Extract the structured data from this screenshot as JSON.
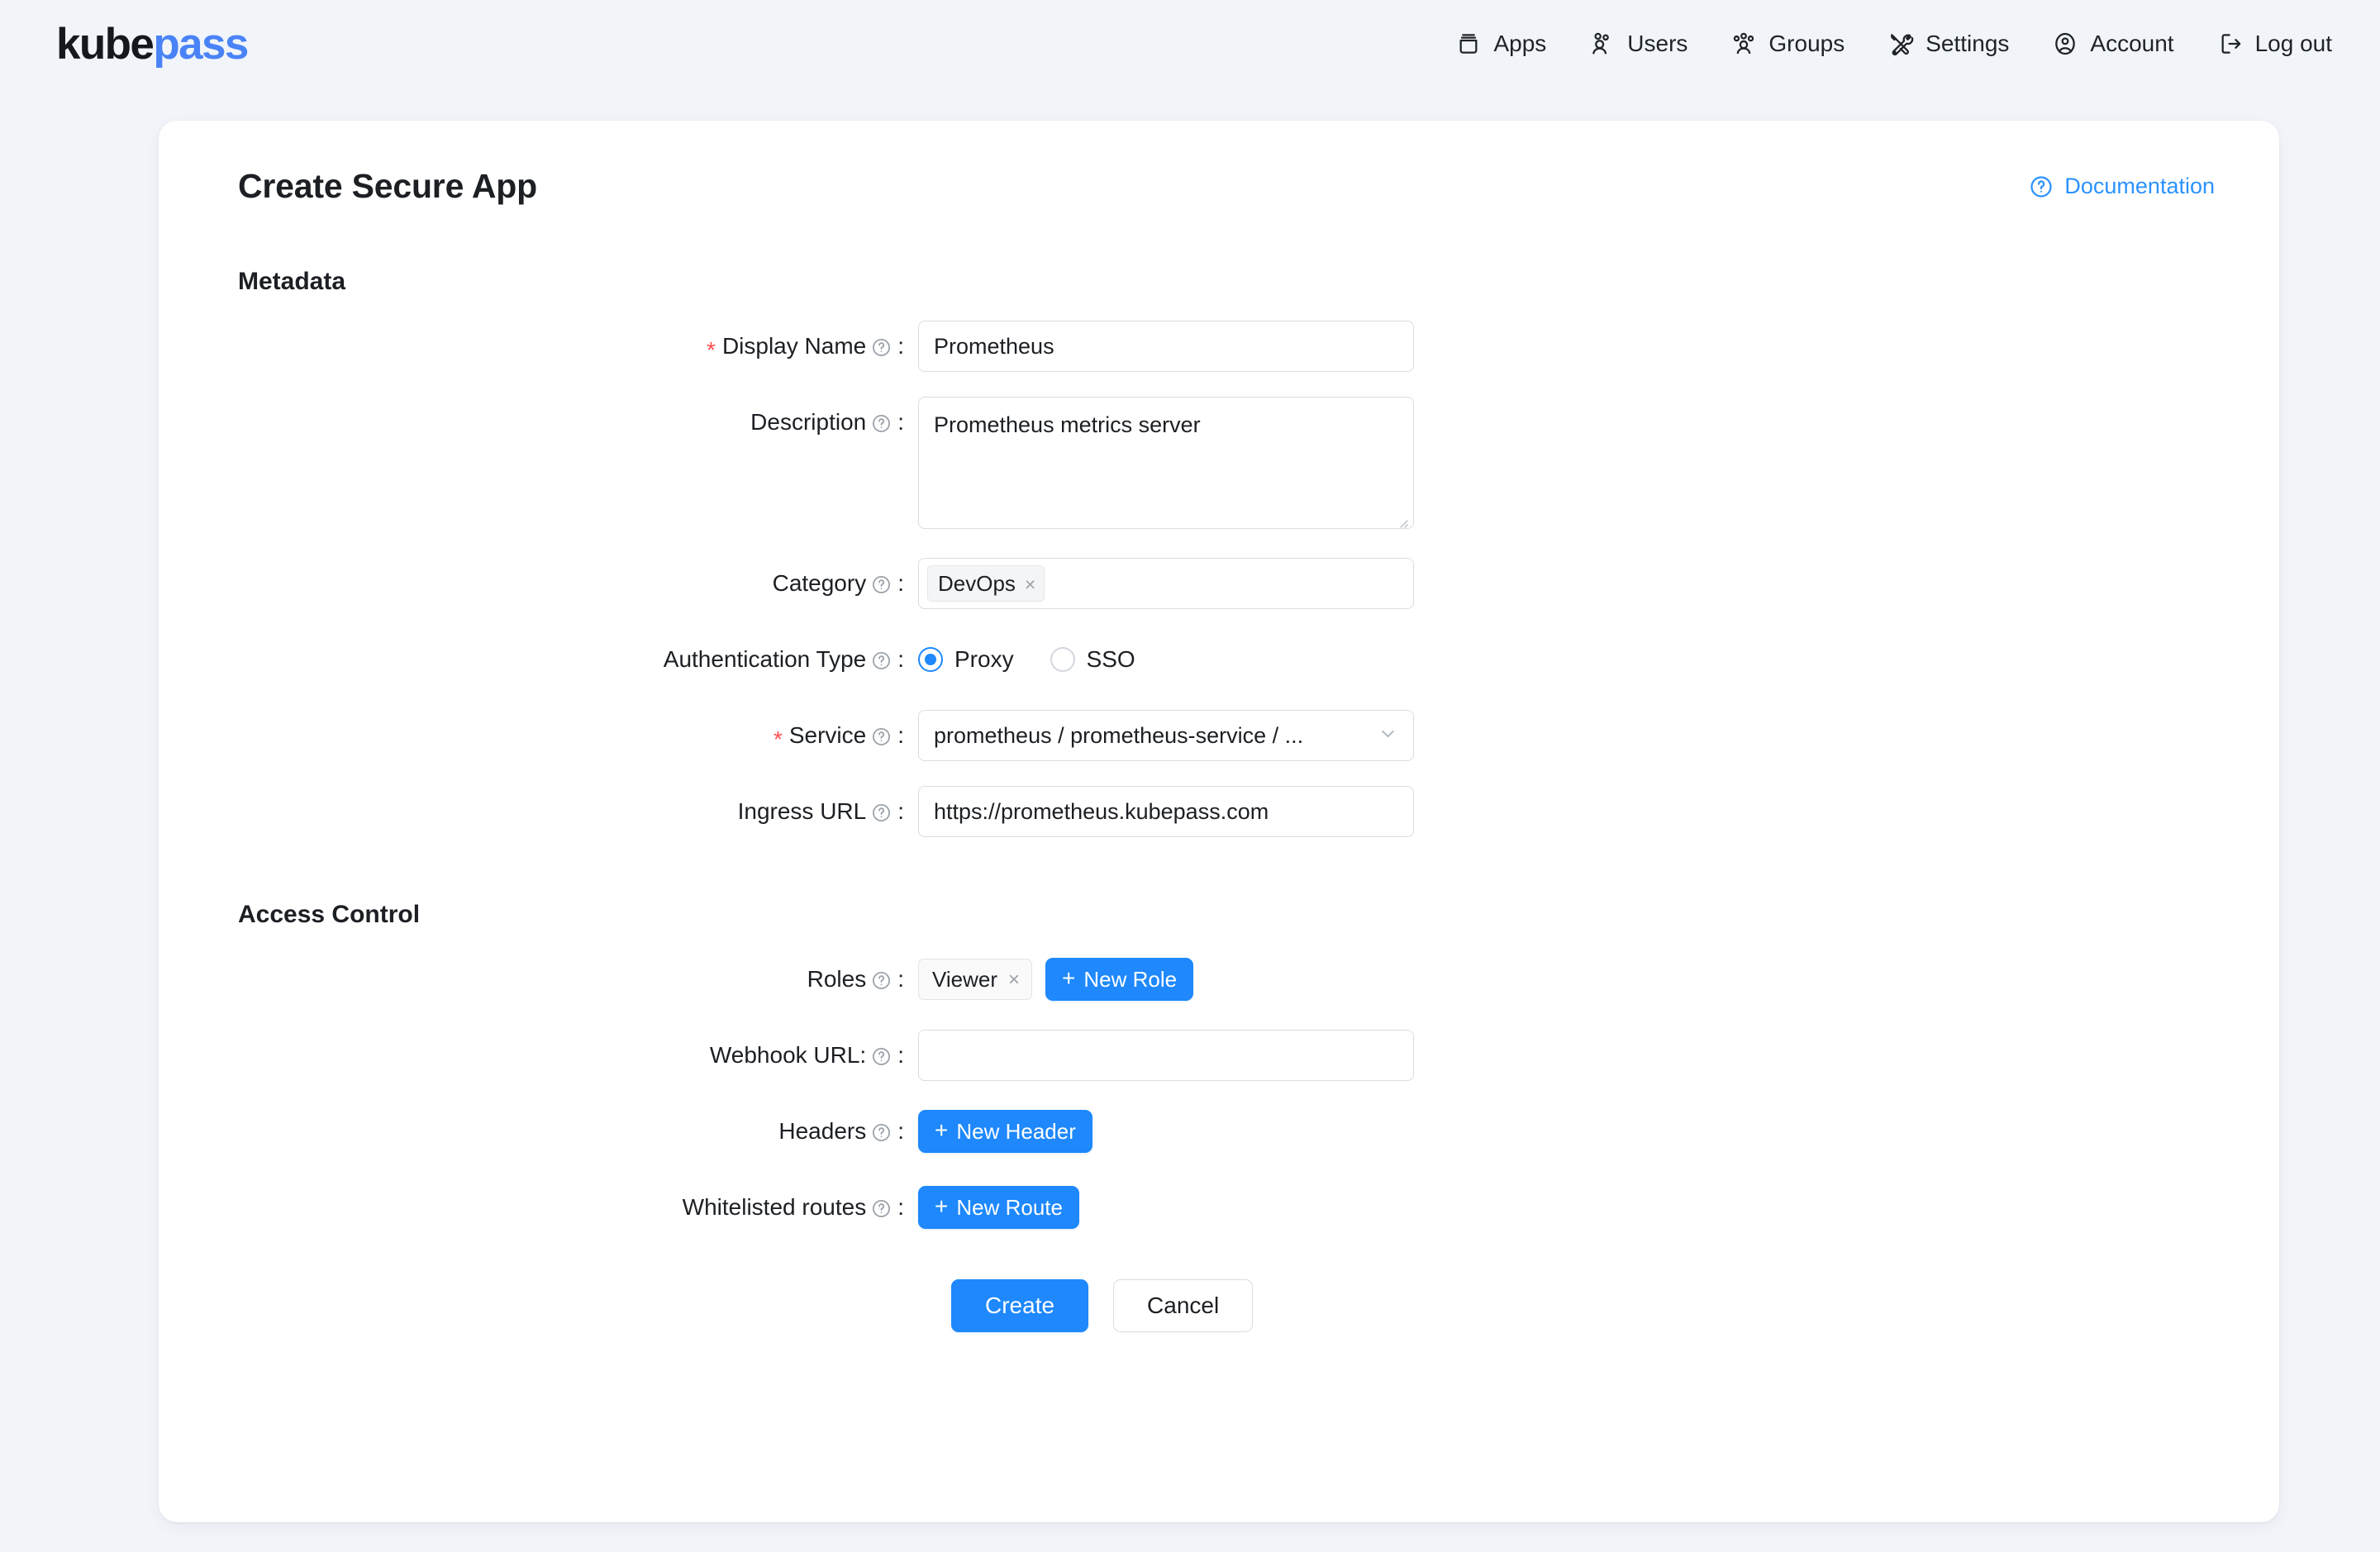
{
  "brand": {
    "part1": "kube",
    "part2": "pass",
    "accent": "#4a83f7"
  },
  "nav": {
    "items": [
      {
        "label": "Apps",
        "icon": "apps-icon"
      },
      {
        "label": "Users",
        "icon": "users-icon"
      },
      {
        "label": "Groups",
        "icon": "groups-icon"
      },
      {
        "label": "Settings",
        "icon": "settings-icon"
      },
      {
        "label": "Account",
        "icon": "account-icon"
      },
      {
        "label": "Log out",
        "icon": "logout-icon"
      }
    ]
  },
  "page": {
    "title": "Create Secure App",
    "documentation_label": "Documentation",
    "documentation_icon": "question-circle-icon",
    "accent_color": "#1e88fc",
    "link_color": "#2b92fd",
    "required_color": "#ff4d4f",
    "background_color": "#f1f5f9"
  },
  "sections": {
    "metadata": {
      "title": "Metadata"
    },
    "access_control": {
      "title": "Access Control"
    }
  },
  "fields": {
    "display_name": {
      "label": "Display Name",
      "required_mark": "*",
      "colon": ":",
      "value": "Prometheus",
      "placeholder": ""
    },
    "description": {
      "label": "Description",
      "colon": ":",
      "value": "Prometheus metrics server",
      "placeholder": ""
    },
    "category": {
      "label": "Category",
      "colon": ":",
      "tags": [
        {
          "text": "DevOps",
          "remove": "×"
        }
      ]
    },
    "auth_type": {
      "label": "Authentication Type",
      "colon": ":",
      "selected": "Proxy",
      "options": [
        "Proxy",
        "SSO"
      ]
    },
    "service": {
      "label": "Service",
      "required_mark": "*",
      "colon": ":",
      "value": "prometheus / prometheus-service / ...",
      "chevron": "chevron-down-icon"
    },
    "ingress_url": {
      "label": "Ingress URL",
      "colon": ":",
      "value": "https://prometheus.kubepass.com",
      "placeholder": ""
    },
    "roles": {
      "label": "Roles",
      "colon": ":",
      "tags": [
        {
          "text": "Viewer",
          "remove": "×"
        }
      ],
      "button": {
        "plus": "+",
        "label": "New Role"
      }
    },
    "webhook_url": {
      "label": "Webhook URL:",
      "colon": ":",
      "value": "",
      "placeholder": ""
    },
    "headers": {
      "label": "Headers",
      "colon": ":",
      "button": {
        "plus": "+",
        "label": "New Header"
      }
    },
    "whitelisted_routes": {
      "label": "Whitelisted routes",
      "colon": ":",
      "button": {
        "plus": "+",
        "label": "New Route"
      }
    }
  },
  "actions": {
    "create_label": "Create",
    "cancel_label": "Cancel"
  }
}
